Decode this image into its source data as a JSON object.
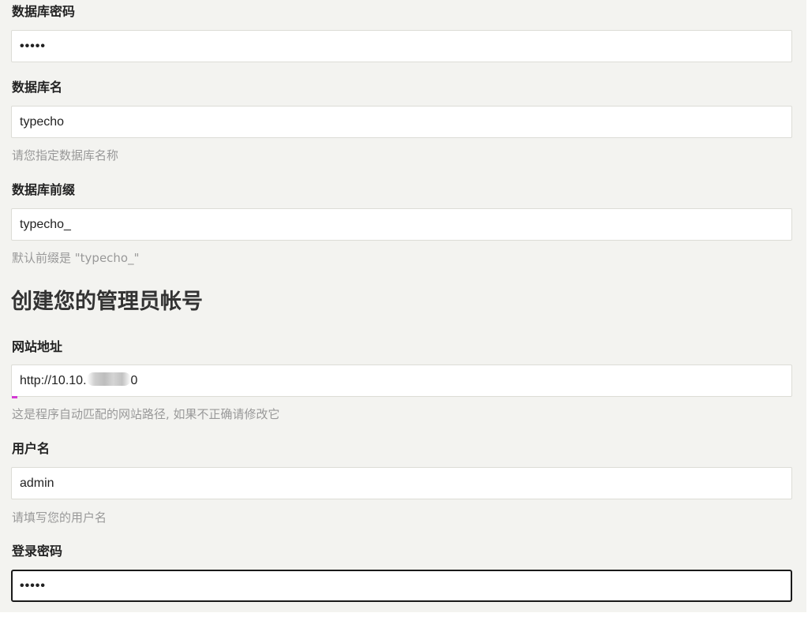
{
  "db_password": {
    "label": "数据库密码",
    "value": "•••••"
  },
  "db_name": {
    "label": "数据库名",
    "value": "typecho",
    "hint": "请您指定数据库名称"
  },
  "db_prefix": {
    "label": "数据库前缀",
    "value": "typecho_",
    "hint": "默认前缀是 \"typecho_\""
  },
  "admin_section": {
    "title": "创建您的管理员帐号"
  },
  "site_url": {
    "label": "网站地址",
    "value_prefix": "http://10.10.",
    "value_suffix": "0",
    "hint": "这是程序自动匹配的网站路径, 如果不正确请修改它"
  },
  "username": {
    "label": "用户名",
    "value": "admin",
    "hint": "请填写您的用户名"
  },
  "login_password": {
    "label": "登录密码",
    "value": "•••••"
  },
  "colors": {
    "panel_bg": "#f3f3f0",
    "field_bg": "#ffffff",
    "field_border": "#dcdcd6",
    "focus_border": "#1a1a1a",
    "hint_text": "#999999",
    "label_text": "#222222"
  }
}
